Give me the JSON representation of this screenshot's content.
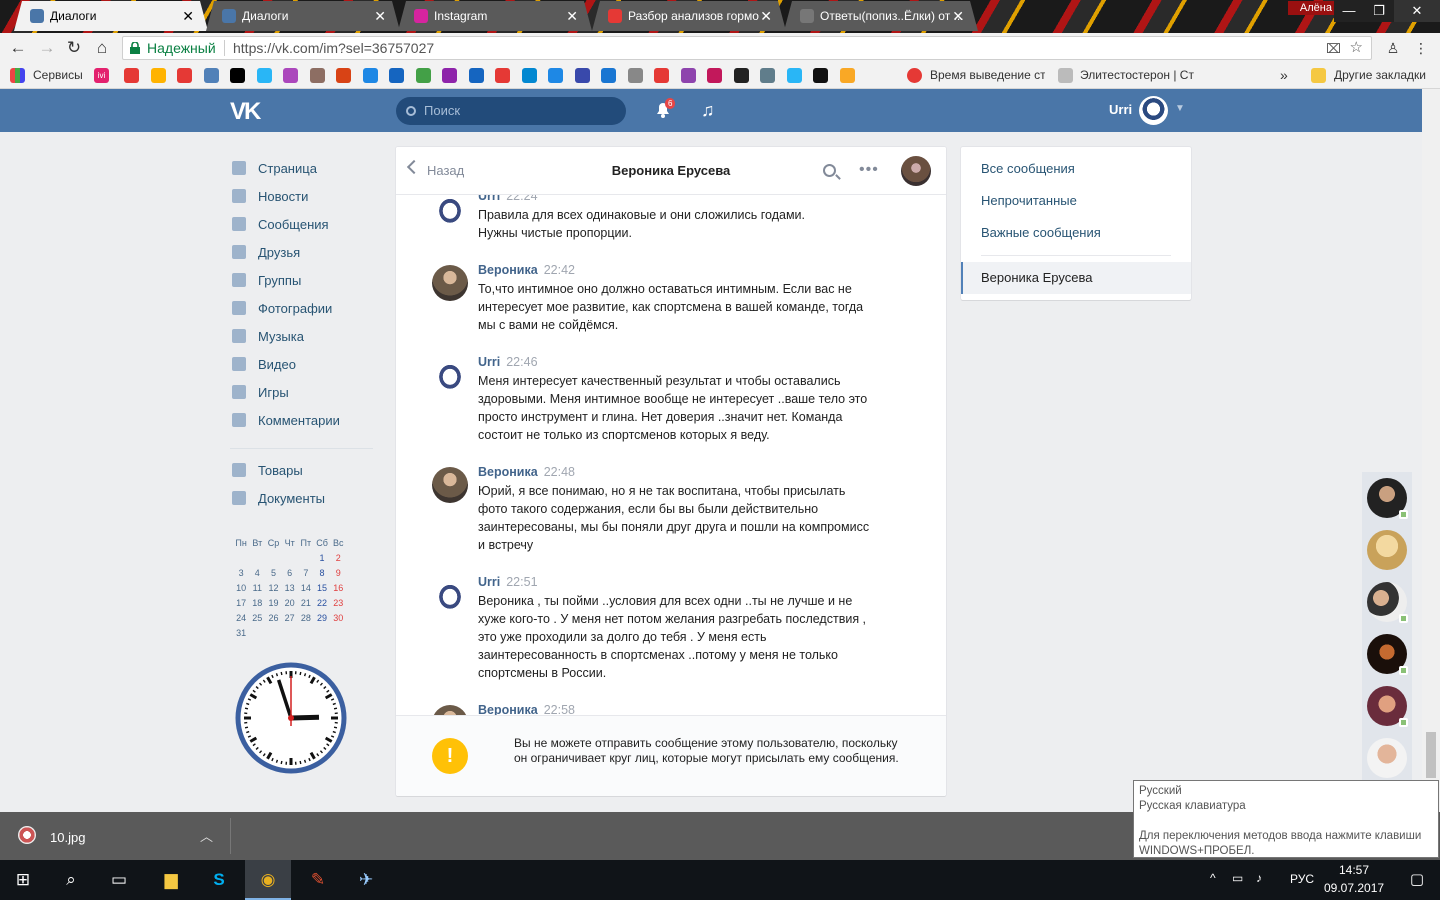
{
  "browser": {
    "tabs": [
      {
        "label": "Диалоги",
        "active": true,
        "color": "#4a76a8"
      },
      {
        "label": "Диалоги",
        "active": false,
        "color": "#4a76a8"
      },
      {
        "label": "Instagram",
        "active": false,
        "color": "#d6249f"
      },
      {
        "label": "Разбор анализов гормо",
        "active": false,
        "color": "#e53935"
      },
      {
        "label": "Ответы(попиз..Ёлки) от ...",
        "active": false,
        "color": "#777777"
      }
    ],
    "tab_close": "✕",
    "profile_name": "Алёна",
    "secure_label": "Надежный",
    "url": "https://vk.com/im?sel=36757027",
    "bookmarks": {
      "services": "Сервисы",
      "ivi": "ivi",
      "item_vremya": "Время выведение ст",
      "item_elitest": "Элитестостерон | Ст",
      "more": "»",
      "other": "Другие закладки"
    }
  },
  "vk": {
    "search_placeholder": "Поиск",
    "notifications_count": "6",
    "user_name": "Urri",
    "menu": [
      "Страница",
      "Новости",
      "Сообщения",
      "Друзья",
      "Группы",
      "Фотографии",
      "Музыка",
      "Видео",
      "Игры",
      "Комментарии"
    ],
    "menu2": [
      "Товары",
      "Документы"
    ],
    "calendar": {
      "weekdays": [
        "Пн",
        "Вт",
        "Ср",
        "Чт",
        "Пт",
        "Сб",
        "Вс"
      ],
      "weeks": [
        [
          "",
          "",
          "",
          "",
          "",
          "1",
          "2"
        ],
        [
          "3",
          "4",
          "5",
          "6",
          "7",
          "8",
          "9"
        ],
        [
          "10",
          "11",
          "12",
          "13",
          "14",
          "15",
          "16"
        ],
        [
          "17",
          "18",
          "19",
          "20",
          "21",
          "22",
          "23"
        ],
        [
          "24",
          "25",
          "26",
          "27",
          "28",
          "29",
          "30"
        ],
        [
          "31",
          "",
          "",
          "",
          "",
          "",
          ""
        ]
      ]
    },
    "clock": {
      "hours": 14,
      "minutes": 57
    }
  },
  "chat": {
    "back_label": "Назад",
    "title": "Вероника Ерусева",
    "messages": [
      {
        "author": "Urri",
        "kind": "urri",
        "time": "22:24",
        "text": "Правила для всех одинаковые и они сложились годами.\nНужны чистые пропорции."
      },
      {
        "author": "Вероника",
        "kind": "ver",
        "time": "22:42",
        "text": "То,что интимное оно должно оставаться интимным. Если вас не интересует мое развитие, как спортсмена в вашей команде, тогда мы с вами не сойдёмся."
      },
      {
        "author": "Urri",
        "kind": "urri",
        "time": "22:46",
        "text": "Меня интересует качественный результат и чтобы оставались здоровыми. Меня интимное вообще не интересует ..ваше тело это просто инструмент и глина. Нет доверия ..значит нет. Команда состоит не только из спортсменов которых я веду."
      },
      {
        "author": "Вероника",
        "kind": "ver",
        "time": "22:48",
        "text": "Юрий, я все понимаю, но я не так воспитана, чтобы присылать фото такого содержания, если бы вы были действительно заинтересованы, мы бы поняли друг друга и пошли на компромисс и встречу"
      },
      {
        "author": "Urri",
        "kind": "urri",
        "time": "22:51",
        "text": "Вероника , ты пойми ..условия для всех одни ..ты не лучше и не хуже кого-то . У меня нет потом желания разгребать последствия , это уже проходили за долго до тебя . У меня есть заинтересованность в спортсменах ..потому у меня не только спортсмены в России."
      },
      {
        "author": "Вероника",
        "kind": "ver",
        "time": "22:58",
        "text": ""
      }
    ],
    "blocked_notice": "Вы не можете отправить сообщение этому пользователю, поскольку он ограничивает круг лиц, которые могут присылать ему сообщения."
  },
  "right_menu": {
    "all": "Все сообщения",
    "unread": "Непрочитанные",
    "important": "Важные сообщения",
    "active_dialog": "Вероника Ерусева"
  },
  "ime": {
    "line1": "Русский",
    "line2": "Русская клавиатура",
    "line3": "Для переключения методов ввода нажмите клавиши WINDOWS+ПРОБЕЛ."
  },
  "downloads": {
    "file": "10.jpg"
  },
  "taskbar": {
    "lang": "РУС",
    "time": "14:57",
    "date": "09.07.2017"
  }
}
